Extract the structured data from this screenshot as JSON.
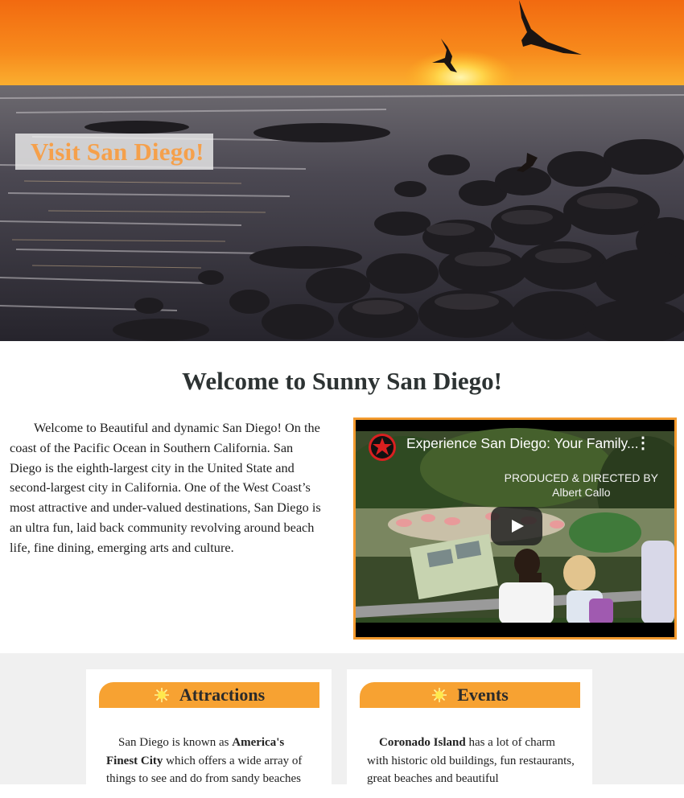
{
  "hero": {
    "title": "Visit San Diego!"
  },
  "welcome": {
    "heading": "Welcome to Sunny San Diego!",
    "intro": "Welcome to Beautiful and dynamic San Diego! On the coast of the Pacific Ocean in Southern California. San Diego is the eighth-largest city in the United State and second-largest city in California. One of the West Coast’s most attractive and under-valued destinations, San Diego is an ultra fun, laid back community revolving around beach life, fine dining, emerging arts and culture."
  },
  "video": {
    "title": "Experience San Diego: Your Family...",
    "credit_line1": "PRODUCED & DIRECTED BY",
    "credit_line2": "Albert Callo",
    "menu_icon": "⋮"
  },
  "cards": [
    {
      "title": "Attractions",
      "body_prefix": "San Diego is known as ",
      "body_bold": "America's Finest City",
      "body_suffix": " which offers a wide array of things to see and do from sandy beaches"
    },
    {
      "title": "Events",
      "body_prefix": "",
      "body_bold": "Coronado Island",
      "body_suffix": " has a lot of charm with historic old buildings, fun restaurants, great beaches and beautiful"
    }
  ],
  "colors": {
    "accent": "#f7a232",
    "hero_title": "#f5a04b",
    "video_border": "#f39a2e"
  }
}
